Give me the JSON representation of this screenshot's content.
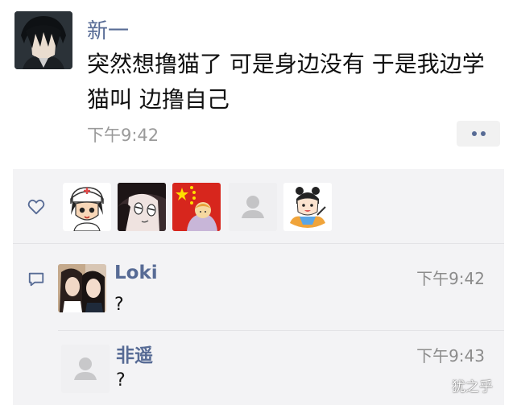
{
  "post": {
    "author": "新一",
    "text": "突然想撸猫了 可是身边没有 于是我边学猫叫 边撸自己",
    "time": "下午9:42",
    "more_icon": "more-dots-icon"
  },
  "likes": {
    "icon": "heart-icon",
    "avatars": [
      "avatar-nurse-cartoon",
      "avatar-anime-girl",
      "avatar-flag-cartoon",
      "avatar-default",
      "avatar-girl-cartoon"
    ]
  },
  "comments": [
    {
      "name": "Loki",
      "text": "?",
      "time": "下午9:42"
    },
    {
      "name": "非遥",
      "text": "?",
      "time": "下午9:43"
    }
  ],
  "comment_icon": "comment-icon",
  "watermark": "犹之乎",
  "colors": {
    "name_link": "#576b95",
    "panel_bg": "#f3f3f5",
    "time_gray": "#9a9a9a"
  }
}
